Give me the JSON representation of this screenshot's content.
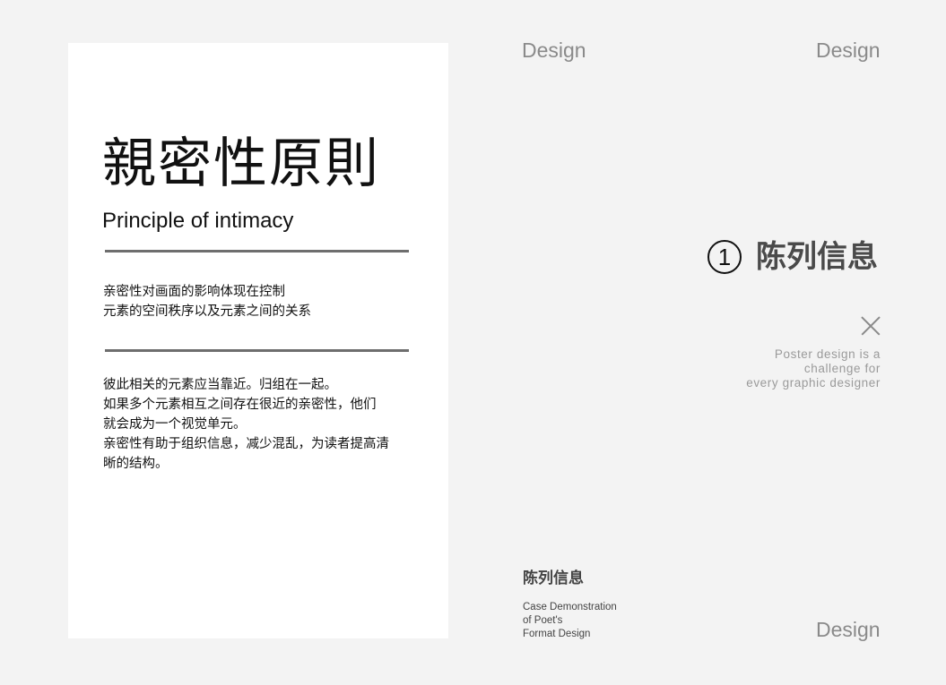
{
  "card": {
    "title": "親密性原則",
    "subtitle": "Principle of intimacy",
    "paragraph_1": "亲密性对画面的影响体现在控制\n元素的空间秩序以及元素之间的关系",
    "paragraph_2": "彼此相关的元素应当靠近。归组在一起。\n如果多个元素相互之间存在很近的亲密性，他们\n就会成为一个视觉单元。\n亲密性有助于组织信息，减少混乱，为读者提高清\n晰的结构。"
  },
  "design_labels": {
    "top_left": "Design",
    "top_right": "Design",
    "bottom_right": "Design"
  },
  "heading": {
    "number": "1",
    "text": "陈列信息"
  },
  "icons": {
    "close": "close-icon"
  },
  "tagline": "Poster design is a\nchallenge for\nevery graphic designer",
  "footer": {
    "title": "陈列信息",
    "subtitle": "Case Demonstration\nof Poet's\nFormat Design"
  },
  "colors": {
    "background": "#f3f3f3",
    "card": "#ffffff",
    "rule": "#6e6e6e",
    "muted": "#8a8a8a"
  }
}
